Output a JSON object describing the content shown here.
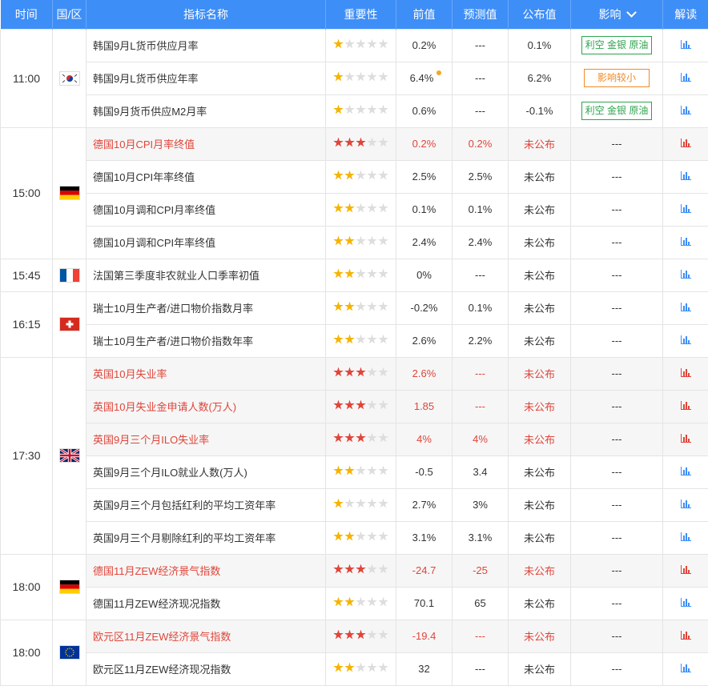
{
  "headers": {
    "time": "时间",
    "region": "国/区",
    "indicator": "指标名称",
    "importance": "重要性",
    "previous": "前值",
    "forecast": "预测值",
    "actual": "公布值",
    "impact": "影响",
    "analysis": "解读"
  },
  "groups": [
    {
      "time": "11:00",
      "flag": "kr-flag-icon",
      "rows": [
        {
          "name": "韩国9月L货币供应月率",
          "stars": 1,
          "prev": "0.2%",
          "forecast": "---",
          "actual": "0.1%",
          "impact": "利空 金银 原油",
          "impact_type": "green",
          "highlight": false
        },
        {
          "name": "韩国9月L货币供应年率",
          "stars": 1,
          "prev": "6.4%",
          "prev_revised": true,
          "forecast": "---",
          "actual": "6.2%",
          "impact": "影响较小",
          "impact_type": "orange",
          "highlight": false
        },
        {
          "name": "韩国9月货币供应M2月率",
          "stars": 1,
          "prev": "0.6%",
          "forecast": "---",
          "actual": "-0.1%",
          "impact": "利空 金银 原油",
          "impact_type": "green",
          "highlight": false
        }
      ]
    },
    {
      "time": "15:00",
      "flag": "de-flag-icon",
      "rows": [
        {
          "name": "德国10月CPI月率终值",
          "stars": 3,
          "prev": "0.2%",
          "forecast": "0.2%",
          "actual": "未公布",
          "impact": "---",
          "highlight": true
        },
        {
          "name": "德国10月CPI年率终值",
          "stars": 2,
          "prev": "2.5%",
          "forecast": "2.5%",
          "actual": "未公布",
          "impact": "---",
          "highlight": false
        },
        {
          "name": "德国10月调和CPI月率终值",
          "stars": 2,
          "prev": "0.1%",
          "forecast": "0.1%",
          "actual": "未公布",
          "impact": "---",
          "highlight": false
        },
        {
          "name": "德国10月调和CPI年率终值",
          "stars": 2,
          "prev": "2.4%",
          "forecast": "2.4%",
          "actual": "未公布",
          "impact": "---",
          "highlight": false
        }
      ]
    },
    {
      "time": "15:45",
      "flag": "fr-flag-icon",
      "rows": [
        {
          "name": "法国第三季度非农就业人口季率初值",
          "stars": 2,
          "prev": "0%",
          "forecast": "---",
          "actual": "未公布",
          "impact": "---",
          "highlight": false
        }
      ]
    },
    {
      "time": "16:15",
      "flag": "ch-flag-icon",
      "rows": [
        {
          "name": "瑞士10月生产者/进口物价指数月率",
          "stars": 2,
          "prev": "-0.2%",
          "forecast": "0.1%",
          "actual": "未公布",
          "impact": "---",
          "highlight": false
        },
        {
          "name": "瑞士10月生产者/进口物价指数年率",
          "stars": 2,
          "prev": "2.6%",
          "forecast": "2.2%",
          "actual": "未公布",
          "impact": "---",
          "highlight": false
        }
      ]
    },
    {
      "time": "17:30",
      "flag": "gb-flag-icon",
      "rows": [
        {
          "name": "英国10月失业率",
          "stars": 3,
          "prev": "2.6%",
          "forecast": "---",
          "actual": "未公布",
          "impact": "---",
          "highlight": true
        },
        {
          "name": "英国10月失业金申请人数(万人)",
          "stars": 3,
          "prev": "1.85",
          "forecast": "---",
          "actual": "未公布",
          "impact": "---",
          "highlight": true
        },
        {
          "name": "英国9月三个月ILO失业率",
          "stars": 3,
          "prev": "4%",
          "forecast": "4%",
          "actual": "未公布",
          "impact": "---",
          "highlight": true
        },
        {
          "name": "英国9月三个月ILO就业人数(万人)",
          "stars": 2,
          "prev": "-0.5",
          "forecast": "3.4",
          "actual": "未公布",
          "impact": "---",
          "highlight": false
        },
        {
          "name": "英国9月三个月包括红利的平均工资年率",
          "stars": 1,
          "prev": "2.7%",
          "forecast": "3%",
          "actual": "未公布",
          "impact": "---",
          "highlight": false
        },
        {
          "name": "英国9月三个月剔除红利的平均工资年率",
          "stars": 2,
          "prev": "3.1%",
          "forecast": "3.1%",
          "actual": "未公布",
          "impact": "---",
          "highlight": false
        }
      ]
    },
    {
      "time": "18:00",
      "flag": "de-flag-icon",
      "rows": [
        {
          "name": "德国11月ZEW经济景气指数",
          "stars": 3,
          "prev": "-24.7",
          "forecast": "-25",
          "actual": "未公布",
          "impact": "---",
          "highlight": true
        },
        {
          "name": "德国11月ZEW经济现况指数",
          "stars": 2,
          "prev": "70.1",
          "forecast": "65",
          "actual": "未公布",
          "impact": "---",
          "highlight": false
        }
      ]
    },
    {
      "time": "18:00",
      "flag": "eu-flag-icon",
      "rows": [
        {
          "name": "欧元区11月ZEW经济景气指数",
          "stars": 3,
          "prev": "-19.4",
          "forecast": "---",
          "actual": "未公布",
          "impact": "---",
          "highlight": true
        },
        {
          "name": "欧元区11月ZEW经济现况指数",
          "stars": 2,
          "prev": "32",
          "forecast": "---",
          "actual": "未公布",
          "impact": "---",
          "highlight": false
        }
      ]
    }
  ]
}
